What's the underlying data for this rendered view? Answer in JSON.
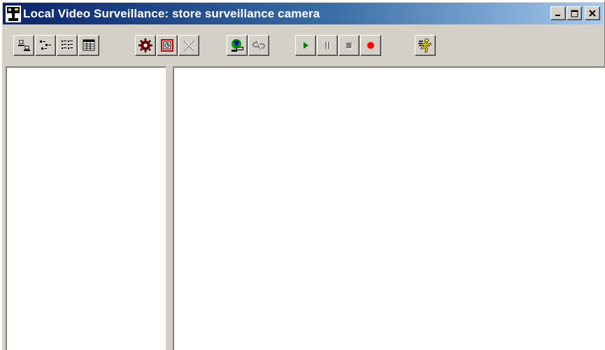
{
  "window": {
    "title": "Local Video Surveillance: store surveillance camera",
    "app_icon": "surveillance-camera-icon",
    "controls": [
      "minimize-icon",
      "maximize-icon",
      "close-icon"
    ]
  },
  "toolbar": {
    "buttons": [
      {
        "name": "large-icons-view",
        "icon": "large-icons-icon"
      },
      {
        "name": "small-icons-view",
        "icon": "small-icons-icon"
      },
      {
        "name": "list-view",
        "icon": "list-icon"
      },
      {
        "name": "details-view",
        "icon": "details-icon"
      },
      {
        "name": "settings",
        "icon": "gear-icon"
      },
      {
        "name": "properties",
        "icon": "properties-icon"
      },
      {
        "name": "delete",
        "icon": "delete-icon",
        "disabled": true
      },
      {
        "name": "connect",
        "icon": "globe-connect-icon"
      },
      {
        "name": "disconnect",
        "icon": "broken-link-icon",
        "disabled": true
      },
      {
        "name": "play",
        "icon": "play-icon"
      },
      {
        "name": "pause",
        "icon": "pause-icon",
        "disabled": true
      },
      {
        "name": "stop",
        "icon": "stop-icon",
        "disabled": true
      },
      {
        "name": "record",
        "icon": "record-icon"
      },
      {
        "name": "exit",
        "icon": "running-man-icon"
      }
    ]
  },
  "colors": {
    "title_gradient_start": "#0a246a",
    "title_gradient_end": "#a6caf0",
    "face": "#d4d0c8",
    "play": "#008000",
    "record": "#ff0000",
    "disabled": "#808080"
  }
}
